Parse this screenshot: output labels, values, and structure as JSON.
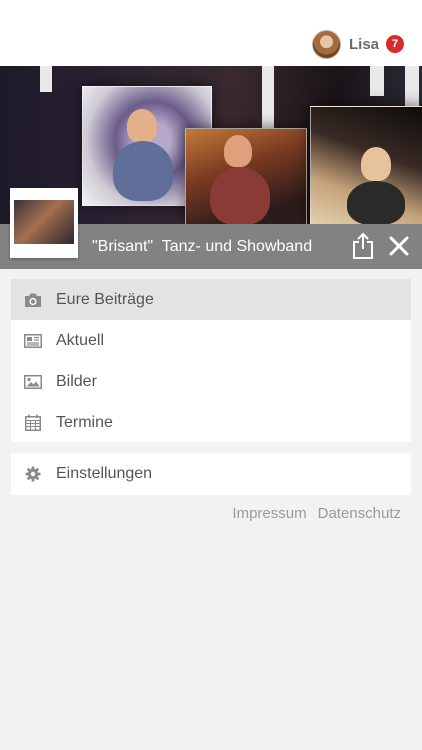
{
  "user": {
    "name": "Lisa",
    "notification_count": "7"
  },
  "header": {
    "title": "\"Brisant\"  Tanz- und Showband"
  },
  "menu": {
    "items": [
      {
        "label": "Eure Beiträge",
        "icon": "camera-icon",
        "active": true
      },
      {
        "label": "Aktuell",
        "icon": "newspaper-icon",
        "active": false
      },
      {
        "label": "Bilder",
        "icon": "image-icon",
        "active": false
      },
      {
        "label": "Termine",
        "icon": "calendar-icon",
        "active": false
      }
    ],
    "settings_label": "Einstellungen"
  },
  "footer": {
    "impressum": "Impressum",
    "datenschutz": "Datenschutz"
  },
  "colors": {
    "badge": "#d62c2c",
    "titlebar": "#787878",
    "active_item": "#e3e3e3"
  }
}
